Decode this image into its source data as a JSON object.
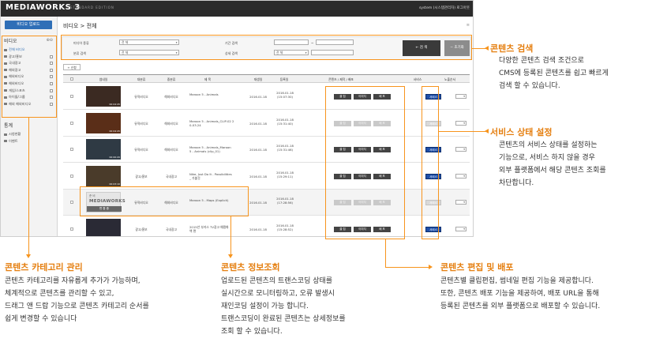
{
  "app": {
    "logo": "MEDIAWORKS 3",
    "edition": "STANDARD EDITION",
    "user": "system (시스템관리자)  로그아웃"
  },
  "sidebar": {
    "upload_label": "비디오 업로드",
    "video_section": "비디오",
    "categories": [
      "전체 비디오",
      "광고/홍보",
      "국내광고",
      "해외광고",
      "해외비디오",
      "해외비디오",
      "게임/스포츠",
      "아이돌/그룹",
      "해외 해외비디오"
    ],
    "stats_section": "통계",
    "stats_items": [
      "시청현황",
      "이벤트"
    ]
  },
  "main": {
    "breadcrumb": "비디오 > 전체",
    "search": {
      "media_type_label": "미디어 종류",
      "media_type_value": "전 체",
      "category_label": "분류 검색",
      "category_value": "전 체",
      "period_label": "기간 검색",
      "period_sep": "~",
      "detail_label": "상세 검색",
      "detail_value": "전 체",
      "search_button": "검 색",
      "reset_button": "초기화"
    },
    "small_button": "+ 신청",
    "columns": [
      "썸네일",
      "대분류",
      "중분류",
      "제 목",
      "재생일",
      "등록일",
      "콘텐츠 / 제작 / 배포",
      "서비스",
      "노출순서"
    ],
    "rows": [
      {
        "timecode": "00:04:45",
        "major": "뮤직비디오",
        "minor": "해외비디오",
        "title": "Maroon 5 - Animals",
        "play": "2016.01.18",
        "reg": "2016.01.18 (15:07:30)",
        "active": true,
        "service": "서비스"
      },
      {
        "timecode": "00:04:45",
        "major": "뮤직비디오",
        "minor": "해외비디오",
        "title": "Maroon 5 - Animals_CLIP-02 2\n0-03.24",
        "play": "2016.01.18",
        "reg": "2016.01.18 (15:31:40)",
        "active": false,
        "service": "서비스"
      },
      {
        "timecode": "00:00:20",
        "major": "뮤직비디오",
        "minor": "해외비디오",
        "title": "Maroon 5 - Animals_Maroon\n5 - Animals (clip_01)",
        "play": "2016.01.18",
        "reg": "2016.01.18 (15:31:46)",
        "active": true,
        "service": "서비스"
      },
      {
        "timecode": "00:03:10",
        "major": "광고/홍보",
        "minor": "국내광고",
        "title": "Nike, Just Do It - Possibilities\n_ 가불것",
        "play": "2016.01.18",
        "reg": "2016.01.18 (15:29:11)",
        "active": true,
        "service": "서비스"
      },
      {
        "timecode": "",
        "major": "뮤직비디오",
        "minor": "해외비디오",
        "title": "Maroon 5 - Maps (Explicit)",
        "play": "2016.01.18",
        "reg": "2016.01.18 (17:28:56)",
        "active": false,
        "service": "서비스",
        "placeholder": "MEDIAWORKS",
        "placeholder_top": "준 비",
        "placeholder_status": "변 환 중"
      },
      {
        "timecode": "00:00:55",
        "major": "광고/홍보",
        "minor": "국내광고",
        "title": "2015년 부카스 TV광고 예쩡화\n백 편",
        "play": "2016.01.18",
        "reg": "2016.01.18 (15:28:52)",
        "active": true,
        "service": "서비스"
      }
    ],
    "content_buttons": [
      "클 립",
      "이미지",
      "배 포"
    ]
  },
  "annotations": {
    "search": {
      "title": "콘텐츠 검색",
      "lines": [
        "다양한 콘텐츠 검색 조건으로",
        "CMS에 등록된 콘텐츠를 쉽고 빠르게",
        "검색 할 수 있습니다."
      ]
    },
    "service": {
      "title": "서비스 상태 설정",
      "lines": [
        "콘텐츠의 서비스 상태를 설정하는",
        "기능으로, 서비스 하지 않을 경우",
        "외부 플랫폼에서 해당 콘텐츠 조회를",
        "차단합니다."
      ]
    },
    "category": {
      "title": "콘텐츠 카테고리 관리",
      "lines": [
        "콘텐츠 카테고리를 자유롭게 추가가 가능하며,",
        "체계적으로 콘텐츠를 관리할 수 있고,",
        "드래그 앤 드랍 기능으로 콘텐츠 카테고리 순서를",
        "쉽게 변경할 수 있습니다"
      ]
    },
    "info": {
      "title": "콘텐츠 정보조회",
      "lines": [
        "업로드된 콘텐츠의 트랜스코딩 상태를",
        "실시간으로 모니터링하고, 오류 발생시",
        "재인코딩 설정이 가능 합니다.",
        "트랜스코딩이 완료된 콘텐츠는 상세정보를",
        "조회 할 수 있습니다."
      ]
    },
    "edit": {
      "title": "콘텐츠 편집 및 배포",
      "lines": [
        "콘텐츠별 클립편집, 썸네일 편집 기능을 제공합니다.",
        "또한, 콘텐츠 배포 기능을 제공하여, 배포 URL을 통해",
        "등록된 콘텐츠를 외부 플랫폼으로 배포할 수 있습니다."
      ]
    }
  }
}
